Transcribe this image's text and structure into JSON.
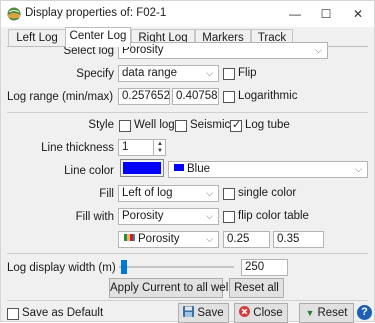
{
  "window": {
    "title": "Display properties of: F02-1",
    "minimize": "—",
    "maximize": "☐",
    "close": "✕"
  },
  "tabs": [
    {
      "label": "Left Log",
      "active": false
    },
    {
      "label": "Center Log",
      "active": true
    },
    {
      "label": "Right Log",
      "active": false
    },
    {
      "label": "Markers",
      "active": false
    },
    {
      "label": "Track",
      "active": false
    }
  ],
  "form": {
    "select_log_label": "Select log",
    "select_log_value": "Porosity",
    "specify_label": "Specify",
    "specify_value": "data range",
    "flip_label": "Flip",
    "flip_checked": false,
    "log_range_label": "Log range (min/max)",
    "log_range_min": "0.257652",
    "log_range_max": "0.407581",
    "logarithmic_label": "Logarithmic",
    "logarithmic_checked": false,
    "style_label": "Style",
    "style_well_log": "Well log",
    "style_seismic": "Seismic",
    "style_log_tube": "Log tube",
    "style_well_log_checked": false,
    "style_seismic_checked": false,
    "style_log_tube_checked": true,
    "line_thickness_label": "Line thickness",
    "line_thickness_value": "1",
    "line_color_label": "Line color",
    "line_color_hex": "#0000ff",
    "line_color_name": "Blue",
    "fill_label": "Fill",
    "fill_value": "Left of log",
    "single_color_label": "single color",
    "single_color_checked": false,
    "fill_with_label": "Fill with",
    "fill_with_value": "Porosity",
    "flip_color_table_label": "flip color table",
    "flip_color_table_checked": false,
    "color_table_value": "Porosity",
    "fill_range_min": "0.25",
    "fill_range_max": "0.35",
    "log_display_width_label": "Log display width (m)",
    "log_display_width_value": "250",
    "log_display_width_fraction": 0.02
  },
  "buttons": {
    "apply_all": "Apply Current to all wells",
    "reset_all": "Reset all",
    "save_default": "Save as Default",
    "save": "Save",
    "close": "Close",
    "reset": "Reset",
    "help": "?"
  },
  "colors": {
    "accent": "#0078d7",
    "line_color": "#0000ff"
  }
}
